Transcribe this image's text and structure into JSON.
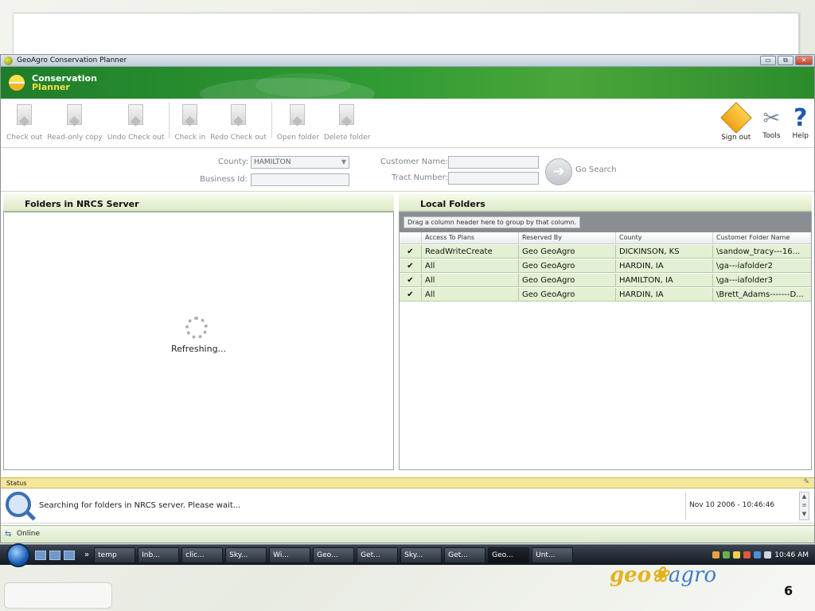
{
  "window": {
    "title": "GeoAgro Conservation Planner",
    "controls": [
      "▭",
      "⧉",
      "✕"
    ]
  },
  "banner": {
    "logo_line1": "Conservation",
    "logo_line2": "Planner"
  },
  "toolbar": {
    "check_out": "Check out",
    "read_only_copy": "Read-only copy",
    "undo_check_out": "Undo Check out",
    "check_in": "Check in",
    "redo_check_out": "Redo Check out",
    "open_folder": "Open folder",
    "delete_folder": "Delete folder",
    "sign_out": "Sign out",
    "tools": "Tools",
    "help": "Help"
  },
  "search": {
    "county_label": "County:",
    "county_value": "HAMILTON",
    "business_id_label": "Business Id:",
    "business_id_value": "",
    "customer_name_label": "Customer Name:",
    "customer_name_value": "",
    "tract_number_label": "Tract Number:",
    "tract_number_value": "",
    "go_search": "Go Search"
  },
  "nrcs_panel": {
    "title": "Folders in NRCS Server",
    "refreshing": "Refreshing..."
  },
  "local_panel": {
    "title": "Local Folders",
    "group_hint": "Drag a column header here to group by that column.",
    "columns": [
      "Access To Plans",
      "Reserved By",
      "County",
      "Customer Folder Name"
    ],
    "rows": [
      {
        "access": "ReadWriteCreate",
        "reserved_by": "Geo GeoAgro",
        "county": "DICKINSON, KS",
        "folder": "\\sandow_tracy---16..."
      },
      {
        "access": "All",
        "reserved_by": "Geo GeoAgro",
        "county": "HARDIN, IA",
        "folder": "\\ga---iafolder2"
      },
      {
        "access": "All",
        "reserved_by": "Geo GeoAgro",
        "county": "HAMILTON, IA",
        "folder": "\\ga---iafolder3"
      },
      {
        "access": "All",
        "reserved_by": "Geo GeoAgro",
        "county": "HARDIN, IA",
        "folder": "\\Brett_Adams-------D..."
      }
    ]
  },
  "status": {
    "header": "Status",
    "message": "Searching for folders in NRCS server. Please wait...",
    "timestamp": "Nov 10 2006 - 10:46:46"
  },
  "bottom_bar": {
    "connection": "Online"
  },
  "taskbar": {
    "items": [
      "temp",
      "Inb...",
      "clic...",
      "Sky...",
      "Wi...",
      "Geo...",
      "Get...",
      "Sky...",
      "Get...",
      "Geo...",
      "Unt..."
    ],
    "active_index": 9,
    "clock": "10:46 AM"
  },
  "slide": {
    "logo_geo": "geo",
    "logo_agro": "agro",
    "page_number": "6"
  }
}
